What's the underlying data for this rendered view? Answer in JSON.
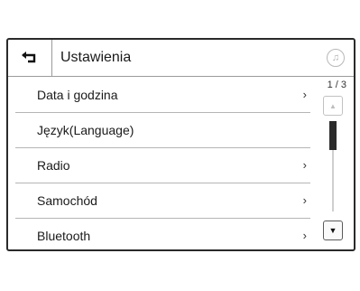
{
  "header": {
    "title": "Ustawienia",
    "back_icon": "back-arrow-icon",
    "music_icon": "music-note-icon"
  },
  "list": {
    "items": [
      {
        "label": "Data i godzina",
        "has_chevron": true
      },
      {
        "label": "Język(Language)",
        "has_chevron": false
      },
      {
        "label": "Radio",
        "has_chevron": true
      },
      {
        "label": "Samochód",
        "has_chevron": true
      },
      {
        "label": "Bluetooth",
        "has_chevron": true
      }
    ],
    "chevron": "›"
  },
  "pager": {
    "indicator": "1 / 3",
    "current_page": 1,
    "total_pages": 3
  }
}
